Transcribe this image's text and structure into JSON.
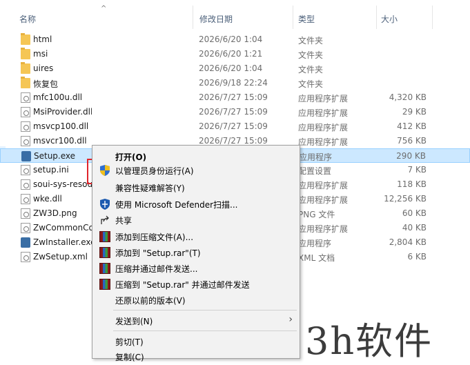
{
  "header": {
    "col_name": "名称",
    "col_date": "修改日期",
    "col_type": "类型",
    "col_size": "大小",
    "sort_indicator": "^"
  },
  "files": [
    {
      "name": "html",
      "date": "2026/6/20 1:04",
      "type": "文件夹",
      "size": "",
      "icon": "folder-icon"
    },
    {
      "name": "msi",
      "date": "2026/6/20 1:21",
      "type": "文件夹",
      "size": "",
      "icon": "folder-icon"
    },
    {
      "name": "uires",
      "date": "2026/6/20 1:04",
      "type": "文件夹",
      "size": "",
      "icon": "folder-icon"
    },
    {
      "name": "恢复包",
      "date": "2026/9/18 22:24",
      "type": "文件夹",
      "size": "",
      "icon": "folder-icon"
    },
    {
      "name": "mfc100u.dll",
      "date": "2026/7/27 15:09",
      "type": "应用程序扩展",
      "size": "4,320 KB",
      "icon": "dll-icon"
    },
    {
      "name": "MsiProvider.dll",
      "date": "2026/7/27 15:09",
      "type": "应用程序扩展",
      "size": "29 KB",
      "icon": "dll-icon"
    },
    {
      "name": "msvcp100.dll",
      "date": "2026/7/27 15:09",
      "type": "应用程序扩展",
      "size": "412 KB",
      "icon": "dll-icon"
    },
    {
      "name": "msvcr100.dll",
      "date": "2026/7/27 15:09",
      "type": "应用程序扩展",
      "size": "756 KB",
      "icon": "dll-icon"
    },
    {
      "name": "Setup.exe",
      "date": "",
      "type": "应用程序",
      "size": "290 KB",
      "icon": "exe-icon",
      "selected": true
    },
    {
      "name": "setup.ini",
      "date": "",
      "type": "配置设置",
      "size": "7 KB",
      "icon": "ini-icon"
    },
    {
      "name": "soui-sys-resou",
      "date": "",
      "type": "应用程序扩展",
      "size": "118 KB",
      "icon": "dll-icon"
    },
    {
      "name": "wke.dll",
      "date": "",
      "type": "应用程序扩展",
      "size": "12,256 KB",
      "icon": "dll-icon"
    },
    {
      "name": "ZW3D.png",
      "date": "",
      "type": "PNG 文件",
      "size": "60 KB",
      "icon": "png-icon"
    },
    {
      "name": "ZwCommonCo",
      "date": "",
      "type": "应用程序扩展",
      "size": "40 KB",
      "icon": "dll-icon"
    },
    {
      "name": "ZwInstaller.exe",
      "date": "",
      "type": "应用程序",
      "size": "2,804 KB",
      "icon": "exe-icon"
    },
    {
      "name": "ZwSetup.xml",
      "date": "",
      "type": "XML 文档",
      "size": "6 KB",
      "icon": "xml-icon"
    }
  ],
  "context_menu": {
    "open": "打开(O)",
    "run_as_admin": "以管理员身份运行(A)",
    "compat": "兼容性疑难解答(Y)",
    "defender": "使用 Microsoft Defender扫描...",
    "share": "共享",
    "add_archive": "添加到压缩文件(A)...",
    "add_rar": "添加到 \"Setup.rar\"(T)",
    "compress_email": "压缩并通过邮件发送...",
    "compress_rar_email": "压缩到 \"Setup.rar\" 并通过邮件发送",
    "restore": "还原以前的版本(V)",
    "send_to": "发送到(N)",
    "cut": "剪切(T)",
    "copy": "复制(C)"
  },
  "watermark": "3h软件",
  "colors": {
    "selection": "#cce8ff",
    "highlight_box": "#e0242b",
    "folder": "#f5c655"
  }
}
